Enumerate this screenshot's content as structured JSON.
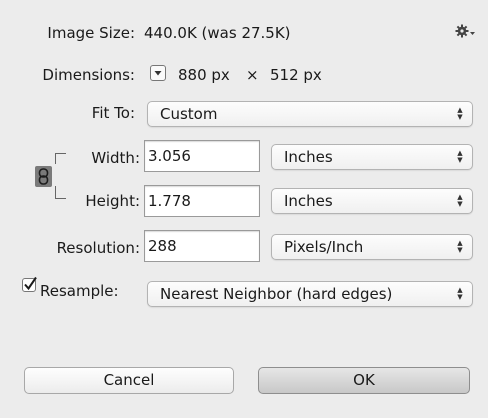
{
  "image_size": {
    "label": "Image Size:",
    "value": "440.0K (was 27.5K)",
    "settings_icon": "gear-icon"
  },
  "dimensions": {
    "label": "Dimensions:",
    "width": "880 px",
    "times": "×",
    "height": "512 px",
    "menu_icon": "triangle-down-icon"
  },
  "fit_to": {
    "label": "Fit To:",
    "value": "Custom"
  },
  "width": {
    "label": "Width:",
    "value": "3.056",
    "unit": "Inches"
  },
  "height": {
    "label": "Height:",
    "value": "1.778",
    "unit": "Inches"
  },
  "link_icon": "chain-link-icon",
  "resolution": {
    "label": "Resolution:",
    "value": "288",
    "unit": "Pixels/Inch"
  },
  "resample": {
    "label": "Resample:",
    "checked": true,
    "value": "Nearest Neighbor (hard edges)"
  },
  "buttons": {
    "cancel": "Cancel",
    "ok": "OK"
  }
}
